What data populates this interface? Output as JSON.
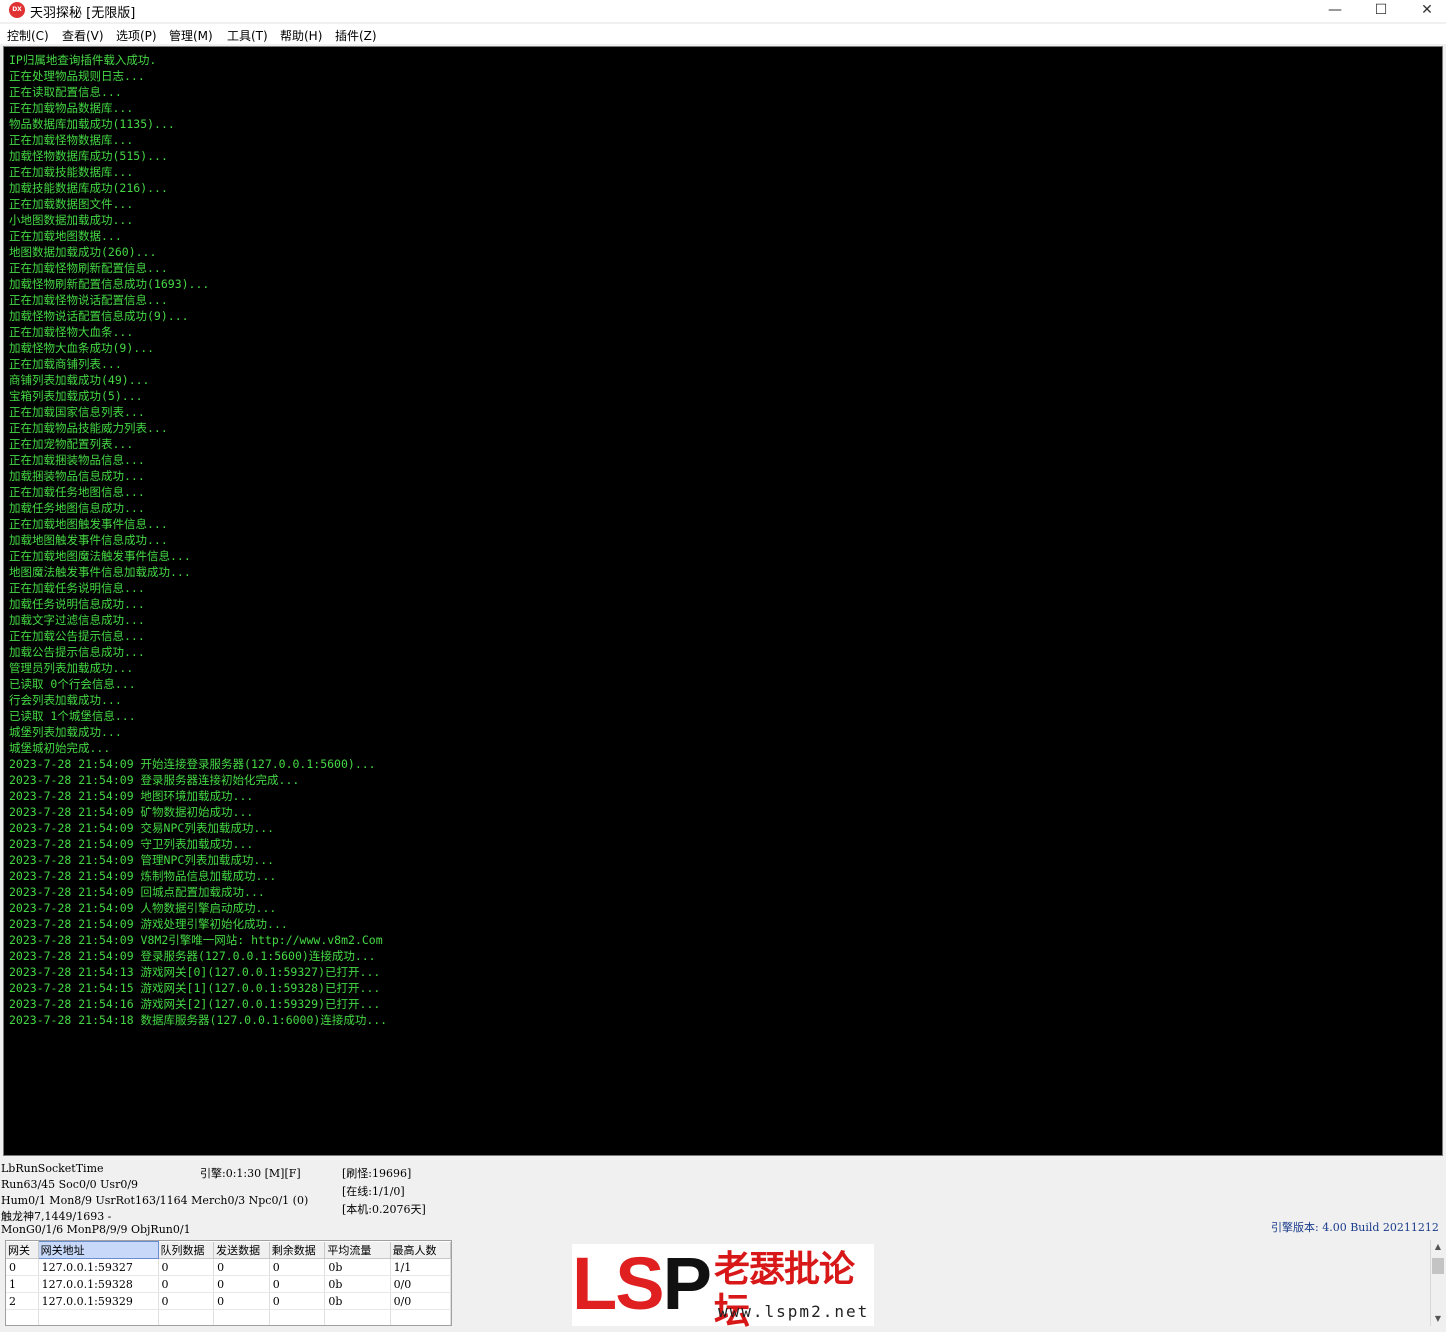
{
  "window": {
    "title": "天羽探秘 [无限版]",
    "icon_text": "DX",
    "minimize_glyph": "—",
    "maximize_glyph": "☐",
    "close_glyph": "✕"
  },
  "menu": [
    "控制(C)",
    "查看(V)",
    "选项(P)",
    "管理(M)",
    "工具(T)",
    "帮助(H)",
    "插件(Z)"
  ],
  "console": {
    "text_color": "#45d945",
    "lines": [
      "IP归属地查询插件载入成功.",
      "正在处理物品规则日志...",
      "正在读取配置信息...",
      "正在加载物品数据库...",
      "物品数据库加载成功(1135)...",
      "正在加载怪物数据库...",
      "加载怪物数据库成功(515)...",
      "正在加载技能数据库...",
      "加载技能数据库成功(216)...",
      "正在加载数据图文件...",
      "小地图数据加载成功...",
      "正在加载地图数据...",
      "地图数据加载成功(260)...",
      "正在加载怪物刷新配置信息...",
      "加载怪物刷新配置信息成功(1693)...",
      "正在加载怪物说话配置信息...",
      "加载怪物说话配置信息成功(9)...",
      "正在加载怪物大血条...",
      "加载怪物大血条成功(9)...",
      "正在加载商铺列表...",
      "商铺列表加载成功(49)...",
      "宝箱列表加载成功(5)...",
      "正在加载国家信息列表...",
      "正在加载物品技能威力列表...",
      "正在加宠物配置列表...",
      "正在加载捆装物品信息...",
      "加载捆装物品信息成功...",
      "正在加载任务地图信息...",
      "加载任务地图信息成功...",
      "正在加载地图触发事件信息...",
      "加载地图触发事件信息成功...",
      "正在加载地图魔法触发事件信息...",
      "地图魔法触发事件信息加载成功...",
      "正在加载任务说明信息...",
      "加载任务说明信息成功...",
      "加载文字过滤信息成功...",
      "正在加载公告提示信息...",
      "加载公告提示信息成功...",
      "管理员列表加载成功...",
      "已读取 0个行会信息...",
      "行会列表加载成功...",
      "已读取 1个城堡信息...",
      "城堡列表加载成功...",
      "城堡城初始完成...",
      "2023-7-28 21:54:09 开始连接登录服务器(127.0.0.1:5600)...",
      "2023-7-28 21:54:09 登录服务器连接初始化完成...",
      "2023-7-28 21:54:09 地图环境加载成功...",
      "2023-7-28 21:54:09 矿物数据初始成功...",
      "2023-7-28 21:54:09 交易NPC列表加载成功...",
      "2023-7-28 21:54:09 守卫列表加载成功...",
      "2023-7-28 21:54:09 管理NPC列表加载成功...",
      "2023-7-28 21:54:09 炼制物品信息加载成功...",
      "2023-7-28 21:54:09 回城点配置加载成功...",
      "2023-7-28 21:54:09 人物数据引擎启动成功...",
      "2023-7-28 21:54:09 游戏处理引擎初始化成功...",
      "2023-7-28 21:54:09 V8M2引擎唯一网站: http://www.v8m2.Com",
      "2023-7-28 21:54:09 登录服务器(127.0.0.1:5600)连接成功...",
      "2023-7-28 21:54:13 游戏网关[0](127.0.0.1:59327)已打开...",
      "2023-7-28 21:54:15 游戏网关[1](127.0.0.1:59328)已打开...",
      "2023-7-28 21:54:16 游戏网关[2](127.0.0.1:59329)已打开...",
      "2023-7-28 21:54:18 数据库服务器(127.0.0.1:6000)连接成功..."
    ]
  },
  "status": {
    "socket_time": "LbRunSocketTime",
    "run_line": "Run63/45 Soc0/0 Usr0/9",
    "hum_line": "Hum0/1 Mon8/9 UsrRot163/1164 Merch0/3 Npc0/1 (0)",
    "monster_line": "触龙神7,1449/1693 -",
    "mon_gen_line": "MonG0/1/6 MonP8/9/9 ObjRun0/1",
    "engine_runtime": "引擎:0:1:30 [M][F]",
    "refresh": "[刷怪:19696]",
    "online": "[在线:1/1/0]",
    "local": "[本机:0.2076天]",
    "engine_version": "引擎版本: 4.00 Build 20211212"
  },
  "gateway_table": {
    "columns": [
      "网关",
      "网关地址",
      "队列数据",
      "发送数据",
      "剩余数据",
      "平均流量",
      "最高人数"
    ],
    "rows": [
      [
        "0",
        "127.0.0.1:59327",
        "0",
        "0",
        "0",
        "0b",
        "1/1"
      ],
      [
        "1",
        "127.0.0.1:59328",
        "0",
        "0",
        "0",
        "0b",
        "0/0"
      ],
      [
        "2",
        "127.0.0.1:59329",
        "0",
        "0",
        "0",
        "0b",
        "0/0"
      ]
    ]
  },
  "watermark": {
    "lsp": "LSP",
    "name": "老瑟批论坛",
    "url": "www.lspm2.net"
  }
}
